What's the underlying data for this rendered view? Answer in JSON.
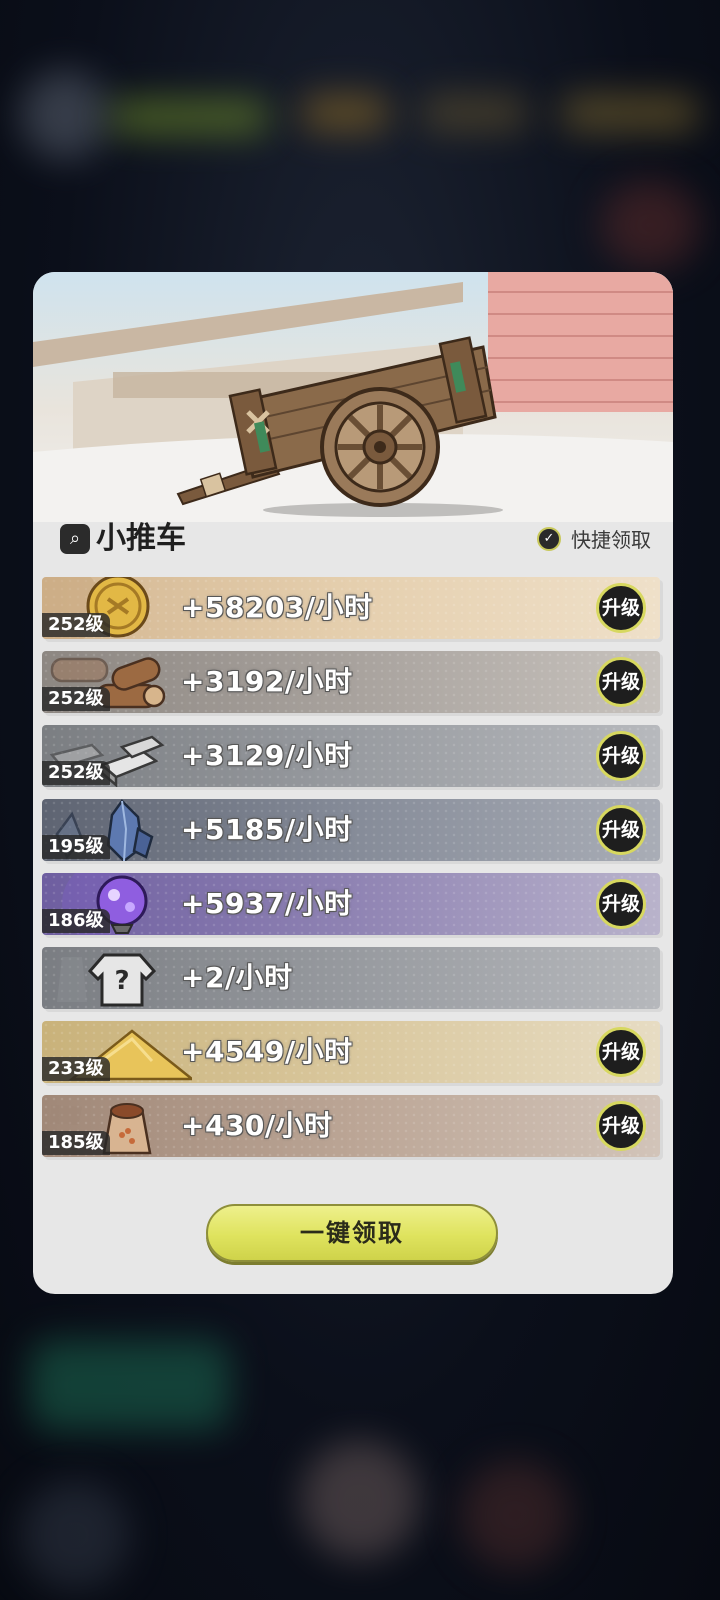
{
  "panel": {
    "title": "小推车",
    "quick_claim_label": "快捷领取"
  },
  "rows": [
    {
      "level": "252级",
      "rate": "+58203/小时",
      "upgrade": "升级",
      "icon": "gold-coin-icon"
    },
    {
      "level": "252级",
      "rate": "+3192/小时",
      "upgrade": "升级",
      "icon": "wood-logs-icon"
    },
    {
      "level": "252级",
      "rate": "+3129/小时",
      "upgrade": "升级",
      "icon": "stone-bricks-icon"
    },
    {
      "level": "195级",
      "rate": "+5185/小时",
      "upgrade": "升级",
      "icon": "crystal-ore-icon"
    },
    {
      "level": "186级",
      "rate": "+5937/小时",
      "upgrade": "升级",
      "icon": "purple-orb-icon"
    },
    {
      "level": "",
      "rate": "+2/小时",
      "upgrade": "",
      "icon": "mystery-armor-icon"
    },
    {
      "level": "233级",
      "rate": "+4549/小时",
      "upgrade": "升级",
      "icon": "sand-pile-icon"
    },
    {
      "level": "185级",
      "rate": "+430/小时",
      "upgrade": "升级",
      "icon": "grain-sack-icon"
    }
  ],
  "claim_all_label": "一键领取",
  "colors": {
    "button_accent": "#dfe35e",
    "panel_bg": "#e7e7e7"
  }
}
